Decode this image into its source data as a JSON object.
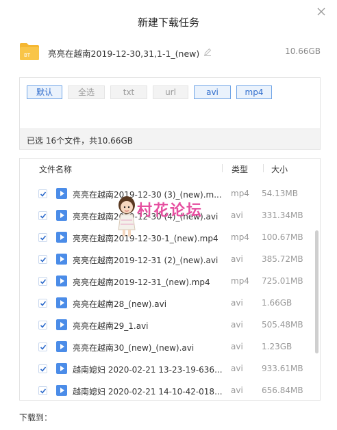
{
  "dialog": {
    "title": "新建下载任务",
    "close_icon": "close-icon"
  },
  "task": {
    "icon_label": "BT",
    "name": "亮亮在越南2019-12-30,31,1-1_(new)",
    "size": "10.66GB"
  },
  "filters": [
    {
      "label": "默认",
      "active": true
    },
    {
      "label": "全选",
      "active": false
    },
    {
      "label": "txt",
      "active": false
    },
    {
      "label": "url",
      "active": false
    },
    {
      "label": "avi",
      "active": true
    },
    {
      "label": "mp4",
      "active": true
    }
  ],
  "summary": "已选 16个文件，共10.66GB",
  "list_header": {
    "name": "文件名称",
    "type": "类型",
    "size": "大小"
  },
  "files": [
    {
      "name": "亮亮在越南2019-12-30 (3)_(new).m...",
      "type": "mp4",
      "size": "54.13MB",
      "checked": true
    },
    {
      "name": "亮亮在越南2019-12-30 (4)_(new).avi",
      "type": "avi",
      "size": "331.34MB",
      "checked": true
    },
    {
      "name": "亮亮在越南2019-12-30-1_(new).mp4",
      "type": "mp4",
      "size": "100.67MB",
      "checked": true
    },
    {
      "name": "亮亮在越南2019-12-31 (2)_(new).avi",
      "type": "avi",
      "size": "385.72MB",
      "checked": true
    },
    {
      "name": "亮亮在越南2019-12-31_(new).mp4",
      "type": "mp4",
      "size": "725.01MB",
      "checked": true
    },
    {
      "name": "亮亮在越南28_(new).avi",
      "type": "avi",
      "size": "1.66GB",
      "checked": true
    },
    {
      "name": "亮亮在越南29_1.avi",
      "type": "avi",
      "size": "505.48MB",
      "checked": true
    },
    {
      "name": "亮亮在越南30_(new)_(new).avi",
      "type": "avi",
      "size": "1.23GB",
      "checked": true
    },
    {
      "name": "越南媳妇 2020-02-21 13-23-19-636...",
      "type": "avi",
      "size": "933.61MB",
      "checked": true
    },
    {
      "name": "越南媳妇 2020-02-21 14-10-42-018...",
      "type": "avi",
      "size": "656.84MB",
      "checked": true
    }
  ],
  "watermark": "村花论坛",
  "save_to_label": "下载到："
}
